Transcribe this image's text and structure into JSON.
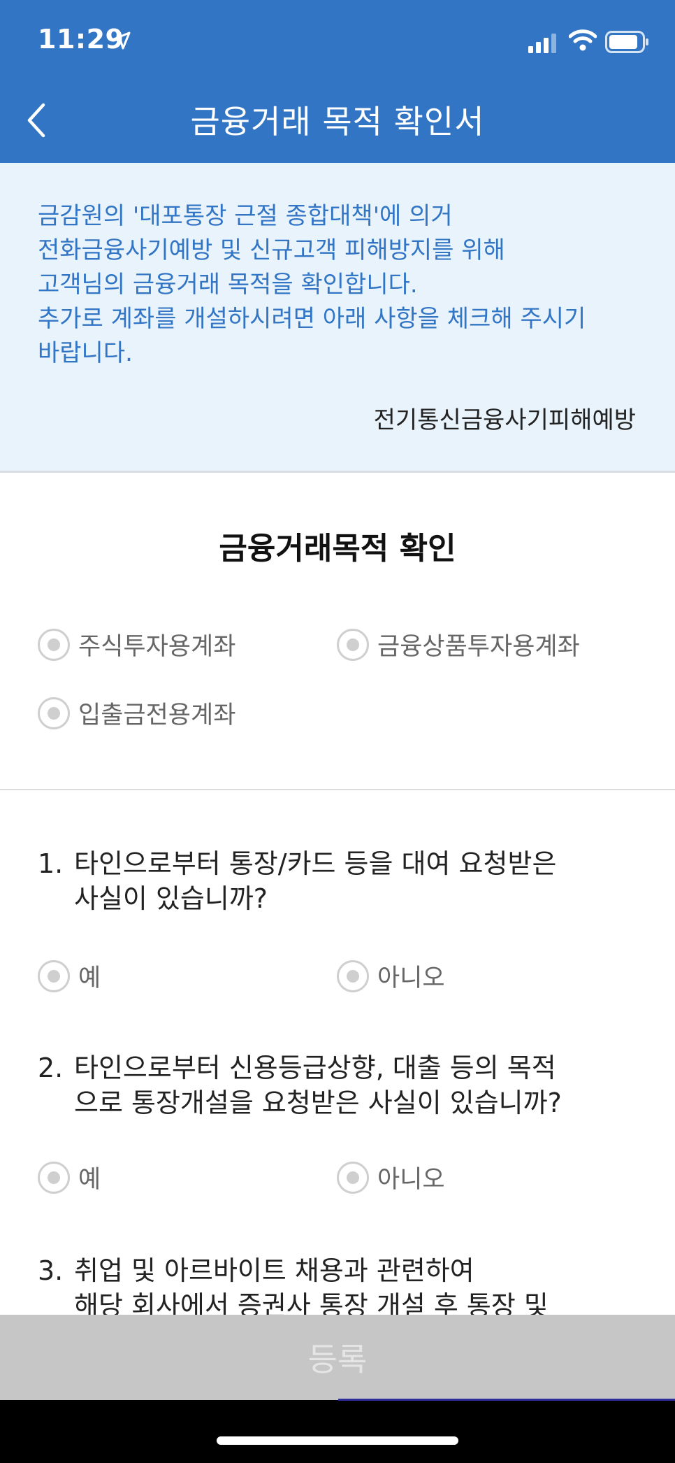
{
  "status_bar": {
    "time": "11:29"
  },
  "header": {
    "title": "금융거래 목적 확인서"
  },
  "notice": {
    "lines": [
      "금감원의 '대포통장 근절 종합대책'에 의거",
      "전화금융사기예방 및 신규고객 피해방지를 위해",
      "고객님의 금융거래 목적을 확인합니다.",
      "추가로 계좌를 개설하시려면 아래 사항을 체크해 주시기",
      "바랍니다."
    ],
    "source": "전기통신금융사기피해예방"
  },
  "purpose": {
    "title": "금융거래목적 확인",
    "options": [
      "주식투자용계좌",
      "금융상품투자용계좌",
      "입출금전용계좌"
    ]
  },
  "questions": [
    {
      "num": "1.",
      "lines": [
        "타인으로부터 통장/카드 등을 대여 요청받은",
        "사실이 있습니까?"
      ],
      "yes": "예",
      "no": "아니오"
    },
    {
      "num": "2.",
      "lines": [
        "타인으로부터 신용등급상향, 대출 등의 목적",
        "으로 통장개설을 요청받은 사실이 있습니까?"
      ],
      "yes": "예",
      "no": "아니오"
    },
    {
      "num": "3.",
      "lines": [
        "취업 및 아르바이트 채용과 관련하여",
        "해당 회사에서 증권사 통장 개설 후 통장 및"
      ]
    }
  ],
  "footer": {
    "register_label": "등록"
  }
}
